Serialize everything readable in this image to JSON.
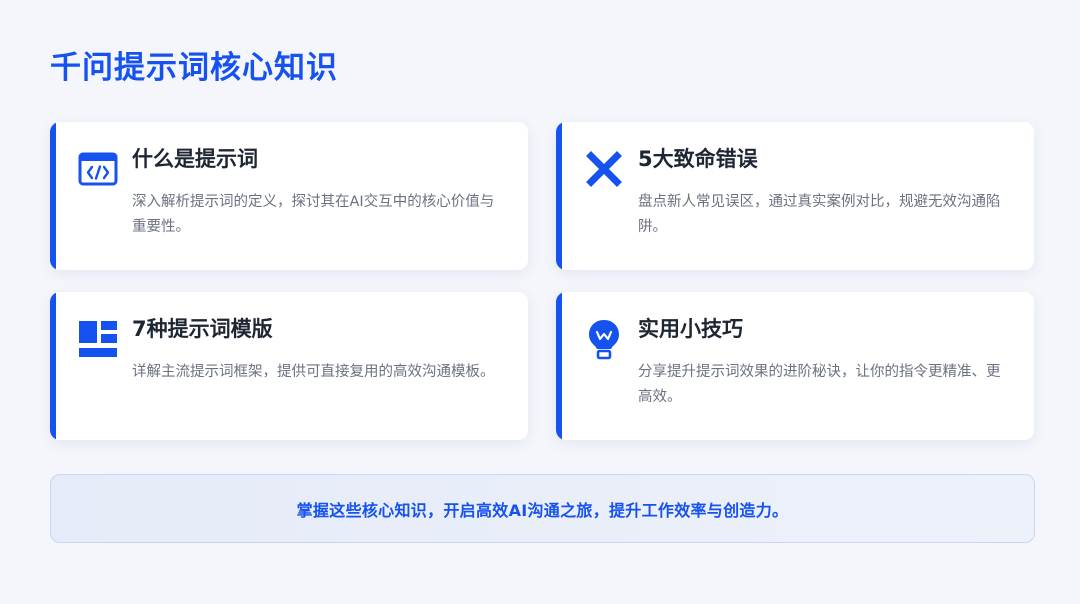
{
  "page": {
    "title": "千问提示词核心知识",
    "accent_color": "#1652f0"
  },
  "cards": [
    {
      "icon": "code-window-icon",
      "title": "什么是提示词",
      "description": "深入解析提示词的定义，探讨其在AI交互中的核心价值与重要性。"
    },
    {
      "icon": "close-x-icon",
      "title": "5大致命错误",
      "description": "盘点新人常见误区，通过真实案例对比，规避无效沟通陷阱。"
    },
    {
      "icon": "template-layout-icon",
      "title": "7种提示词模版",
      "description": "详解主流提示词框架，提供可直接复用的高效沟通模板。"
    },
    {
      "icon": "lightbulb-icon",
      "title": "实用小技巧",
      "description": "分享提升提示词效果的进阶秘诀，让你的指令更精准、更高效。"
    }
  ],
  "summary": {
    "text": "掌握这些核心知识，开启高效AI沟通之旅，提升工作效率与创造力。"
  }
}
